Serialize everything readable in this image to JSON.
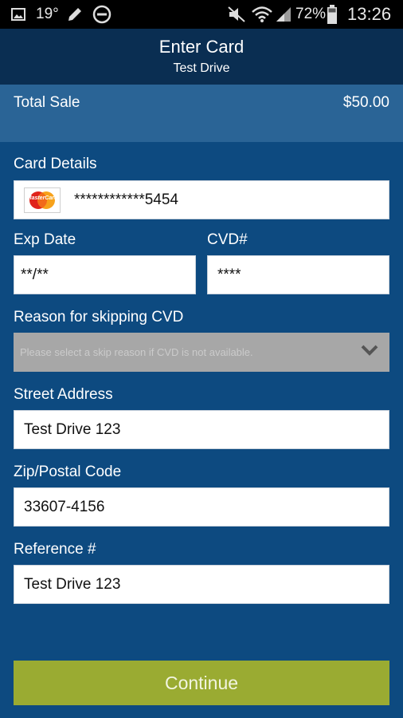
{
  "status_bar": {
    "temperature": "19°",
    "battery": "72%",
    "time": "13:26",
    "icons": [
      "image-icon",
      "pencil-icon",
      "do-not-disturb-icon",
      "mute-icon",
      "wifi-icon",
      "signal-icon",
      "battery-icon"
    ]
  },
  "header": {
    "title": "Enter Card",
    "subtitle": "Test Drive"
  },
  "summary": {
    "total_label": "Total Sale",
    "total_amount": "$50.00"
  },
  "form": {
    "card_details_label": "Card Details",
    "card_number": "************5454",
    "card_brand": "MasterCard",
    "exp_date_label": "Exp Date",
    "exp_date_value": "**/**",
    "cvd_label": "CVD#",
    "cvd_value": "****",
    "skip_reason_label": "Reason for skipping CVD",
    "skip_reason_placeholder": "Please select a skip reason if CVD is not available.",
    "street_label": "Street Address",
    "street_value": "Test Drive 123",
    "zip_label": "Zip/Postal Code",
    "zip_value": "33607-4156",
    "reference_label": "Reference #",
    "reference_value": "Test Drive 123"
  },
  "actions": {
    "continue_label": "Continue"
  },
  "colors": {
    "background": "#0d4a80",
    "header": "#0a2e52",
    "total_bar": "#2a6496",
    "continue_button": "#9aab32"
  }
}
